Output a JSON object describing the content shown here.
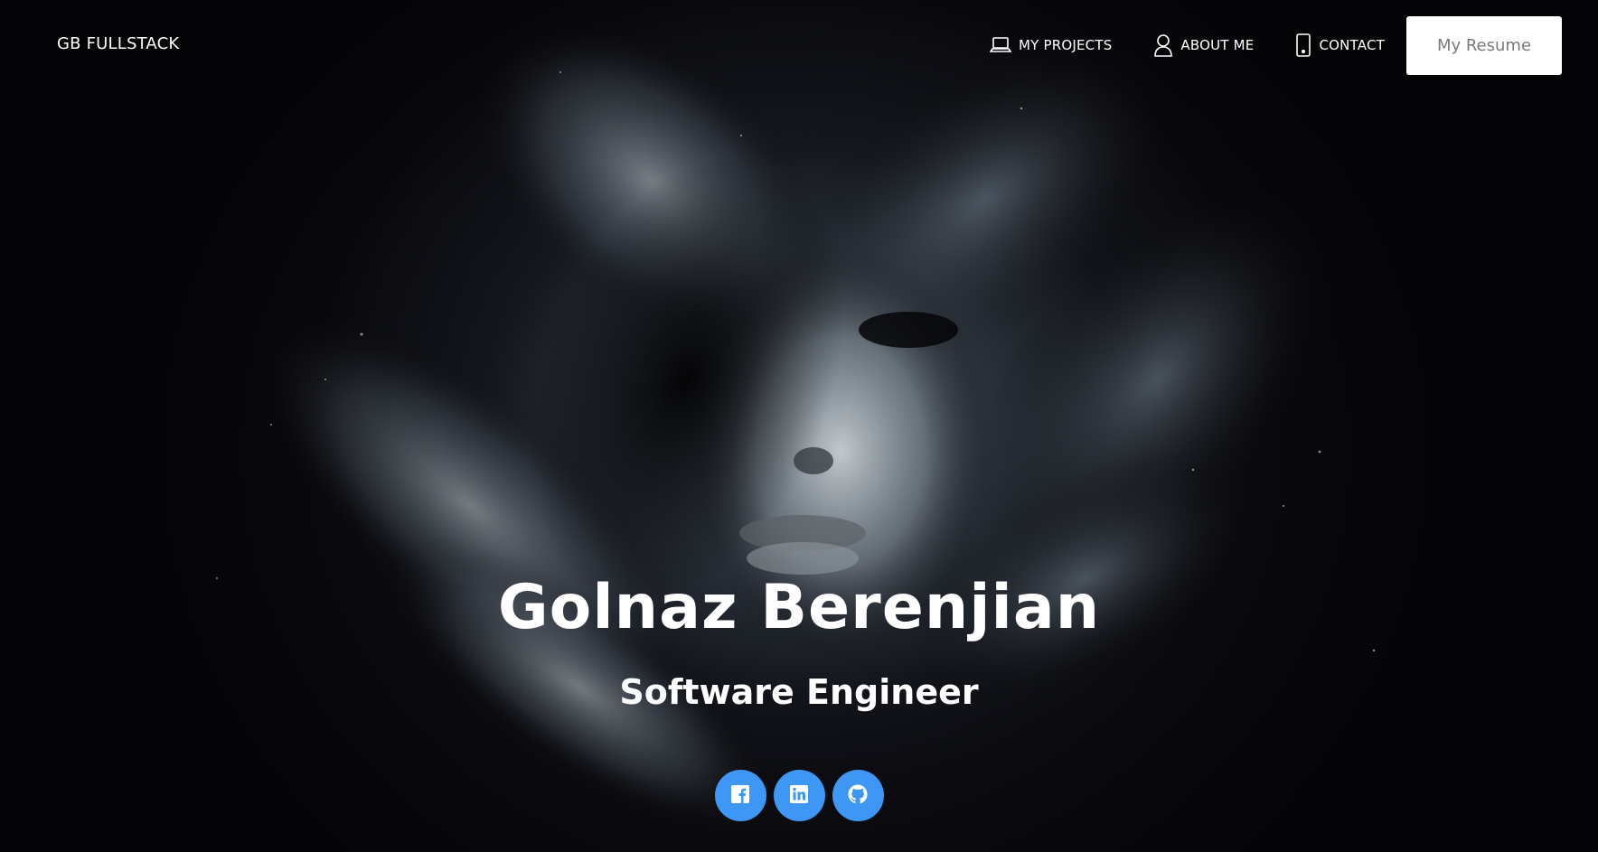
{
  "brand": "GB FULLSTACK",
  "nav": {
    "items": [
      {
        "label": "MY PROJECTS",
        "icon": "laptop-icon"
      },
      {
        "label": "ABOUT ME",
        "icon": "user-icon"
      },
      {
        "label": "CONTACT",
        "icon": "phone-icon"
      }
    ],
    "resume_label": "My Resume"
  },
  "hero": {
    "name": "Golnaz Berenjian",
    "subtitle": "Software Engineer",
    "background": "dark cosmic smoke portrait"
  },
  "social": [
    {
      "icon": "facebook-icon"
    },
    {
      "icon": "linkedin-icon"
    },
    {
      "icon": "github-icon"
    }
  ],
  "colors": {
    "accent": "#3f97f5",
    "text": "#ffffff",
    "background": "#050407"
  }
}
